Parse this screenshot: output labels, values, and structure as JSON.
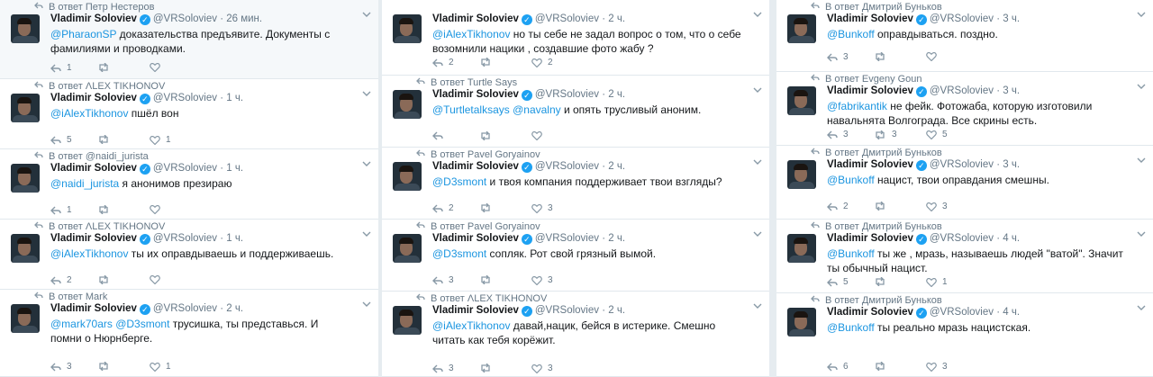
{
  "columns": [
    {
      "tweets": [
        {
          "reply_to": "В ответ Петр Нестеров",
          "name": "Vladimir Soloviev",
          "handle": "@VRSoloviev",
          "time": "26 мин.",
          "mention": "@PharaonSP",
          "text": " доказательства предъявите. Документы с фамилиями и проводками.",
          "replies": "1",
          "retweets": "",
          "likes": "",
          "highlight": true
        },
        {
          "reply_to": "В ответ ΛLEX TIKHONOV",
          "name": "Vladimir Soloviev",
          "handle": "@VRSoloviev",
          "time": "1 ч.",
          "mention": "@iAlexTikhonov",
          "text": " пшёл вон",
          "replies": "5",
          "retweets": "",
          "likes": "1"
        },
        {
          "reply_to": "В ответ @naidi_jurista",
          "name": "Vladimir Soloviev",
          "handle": "@VRSoloviev",
          "time": "1 ч.",
          "mention": "@naidi_jurista",
          "text": " я анонимов презираю",
          "replies": "1",
          "retweets": "",
          "likes": ""
        },
        {
          "reply_to": "В ответ ΛLEX TIKHONOV",
          "name": "Vladimir Soloviev",
          "handle": "@VRSoloviev",
          "time": "1 ч.",
          "mention": "@iAlexTikhonov",
          "text": " ты их оправдываешь и поддерживаешь.",
          "replies": "2",
          "retweets": "",
          "likes": ""
        },
        {
          "reply_to": "В ответ Mark",
          "name": "Vladimir Soloviev",
          "handle": "@VRSoloviev",
          "time": "2 ч.",
          "mention": "@mark70ars @D3smont",
          "text": " трусишка, ты представься.  И помни о Нюрнберге.",
          "replies": "3",
          "retweets": "",
          "likes": "1"
        }
      ]
    },
    {
      "tweets": [
        {
          "reply_to": "",
          "name": "Vladimir Soloviev",
          "handle": "@VRSoloviev",
          "time": "2 ч.",
          "mention": "@iAlexTikhonov",
          "text": " но ты себе не задал вопрос о том, что о себе возомнили нацики , создавшие фото жабу ?",
          "replies": "2",
          "retweets": "",
          "likes": "2"
        },
        {
          "reply_to": "В ответ Turtle Says",
          "name": "Vladimir Soloviev",
          "handle": "@VRSoloviev",
          "time": "2 ч.",
          "mention": "@Turtletalksays @navalny",
          "text": " и опять трусливый аноним.",
          "replies": "",
          "retweets": "",
          "likes": ""
        },
        {
          "reply_to": "В ответ Pavel Goryainov",
          "name": "Vladimir Soloviev",
          "handle": "@VRSoloviev",
          "time": "2 ч.",
          "mention": "@D3smont",
          "text": " и твоя компания поддерживает твои взгляды?",
          "replies": "2",
          "retweets": "",
          "likes": "3"
        },
        {
          "reply_to": "В ответ Pavel Goryainov",
          "name": "Vladimir Soloviev",
          "handle": "@VRSoloviev",
          "time": "2 ч.",
          "mention": "@D3smont",
          "text": " сопляк. Рот свой грязный вымой.",
          "replies": "3",
          "retweets": "",
          "likes": "3"
        },
        {
          "reply_to": "В ответ ΛLEX TIKHONOV",
          "name": "Vladimir Soloviev",
          "handle": "@VRSoloviev",
          "time": "2 ч.",
          "mention": "@iAlexTikhonov",
          "text": " давай,нацик, бейся в истерике. Смешно читать как тебя корёжит.",
          "replies": "3",
          "retweets": "",
          "likes": "3"
        }
      ]
    },
    {
      "tweets": [
        {
          "reply_to": "В ответ Дмитрий Буньков",
          "name": "Vladimir Soloviev",
          "handle": "@VRSoloviev",
          "time": "3 ч.",
          "mention": "@Bunkoff",
          "text": " оправдываться. поздно.",
          "replies": "3",
          "retweets": "",
          "likes": ""
        },
        {
          "reply_to": "В ответ Evgeny Goun",
          "name": "Vladimir Soloviev",
          "handle": "@VRSoloviev",
          "time": "3 ч.",
          "mention": "@fabrikantik",
          "text": " не фейк. Фотожаба, которую изготовили навальнята Волгограда. Все скрины есть.",
          "replies": "3",
          "retweets": "3",
          "likes": "5"
        },
        {
          "reply_to": "В ответ Дмитрий Буньков",
          "name": "Vladimir Soloviev",
          "handle": "@VRSoloviev",
          "time": "3 ч.",
          "mention": "@Bunkoff",
          "text": " нацист, твои оправдания смешны.",
          "replies": "2",
          "retweets": "",
          "likes": "3"
        },
        {
          "reply_to": "В ответ Дмитрий Буньков",
          "name": "Vladimir Soloviev",
          "handle": "@VRSoloviev",
          "time": "4 ч.",
          "mention": "@Bunkoff",
          "text": " ты же , мразь, называешь людей \"ватой\". Значит ты обычный нацист.",
          "replies": "5",
          "retweets": "",
          "likes": "1"
        },
        {
          "reply_to": "В ответ Дмитрий Буньков",
          "name": "Vladimir Soloviev",
          "handle": "@VRSoloviev",
          "time": "4 ч.",
          "mention": "@Bunkoff",
          "text": " ты реально мразь нацистская.",
          "replies": "6",
          "retweets": "",
          "likes": "3"
        }
      ]
    }
  ]
}
